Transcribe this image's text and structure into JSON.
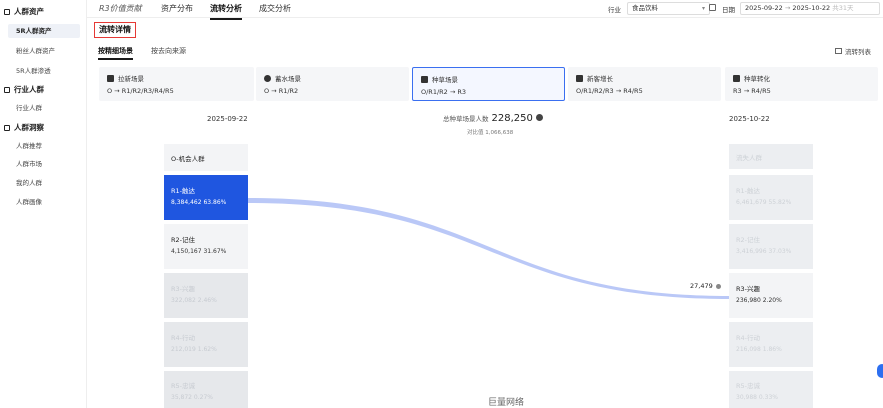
{
  "sidebar": {
    "groups": [
      {
        "label": "人群资产",
        "items": [
          "5R人群资产",
          "粉丝人群资产",
          "5R人群渗透"
        ]
      },
      {
        "label": "行业人群",
        "items": [
          "行业人群"
        ]
      },
      {
        "label": "人群洞察",
        "items": [
          "人群推荐",
          "人群市场",
          "我的人群",
          "人群画像"
        ]
      }
    ]
  },
  "topbar": {
    "tabs": [
      "R3价值贡献",
      "资产分布",
      "流转分析",
      "成交分析"
    ],
    "industry_label": "行业",
    "industry_value": "食品饮料",
    "date_label": "日期",
    "date_start": "2025-09-22",
    "date_sep": "→",
    "date_end": "2025-10-22",
    "date_span": "共31天"
  },
  "section": {
    "title": "流转详情",
    "subtabs": [
      "按精细场景",
      "按去向来源"
    ],
    "flow_list": "流转列表"
  },
  "cards": [
    {
      "title": "拉新场景",
      "sub": "O → R1/R2/R3/R4/R5",
      "icon": "magnet-icon"
    },
    {
      "title": "蓄水场景",
      "sub": "O → R1/R2",
      "icon": "water-drop-icon"
    },
    {
      "title": "种草场景",
      "sub": "O/R1/R2 → R3",
      "icon": "sprout-icon"
    },
    {
      "title": "新客增长",
      "sub": "O/R1/R2/R3 → R4/R5",
      "icon": "growth-icon"
    },
    {
      "title": "种草转化",
      "sub": "R3 → R4/R5",
      "icon": "conversion-icon"
    }
  ],
  "flow": {
    "left_date": "2025-09-22",
    "right_date": "2025-10-22",
    "total_label": "总种草场景人数",
    "total_value": "228,250",
    "compare_label": "对比值",
    "compare_value": "1,066,638",
    "link_value": "27,479",
    "left_nodes": [
      {
        "title": "O-机会人群",
        "value": "",
        "pct": ""
      },
      {
        "title": "R1-触达",
        "value": "8,384,462",
        "pct": "63.86%"
      },
      {
        "title": "R2-记住",
        "value": "4,150,167",
        "pct": "31.67%"
      },
      {
        "title": "R3-兴趣",
        "value": "322,082",
        "pct": "2.46%"
      },
      {
        "title": "R4-行动",
        "value": "212,019",
        "pct": "1.62%"
      },
      {
        "title": "R5-忠诚",
        "value": "35,872",
        "pct": "0.27%"
      }
    ],
    "right_nodes": [
      {
        "title": "流失人群",
        "value": "",
        "pct": ""
      },
      {
        "title": "R1-触达",
        "value": "6,461,679",
        "pct": "55.82%"
      },
      {
        "title": "R2-记住",
        "value": "3,416,996",
        "pct": "37.03%"
      },
      {
        "title": "R3-兴趣",
        "value": "236,980",
        "pct": "2.20%"
      },
      {
        "title": "R4-行动",
        "value": "216,098",
        "pct": "1.86%"
      },
      {
        "title": "R5-忠诚",
        "value": "30,988",
        "pct": "0.33%"
      }
    ]
  },
  "watermark": "巨量网络"
}
